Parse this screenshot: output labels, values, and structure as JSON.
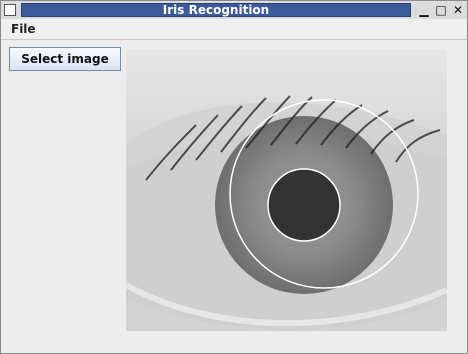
{
  "window": {
    "title": "Iris Recognition",
    "controls": {
      "minimize_icon": "minimize-icon",
      "maximize_icon": "maximize-icon",
      "close_icon": "close-icon"
    }
  },
  "menubar": {
    "items": [
      {
        "label": "File"
      }
    ]
  },
  "toolbar": {
    "select_image_label": "Select image"
  },
  "image": {
    "description_visible": "grayscale eye with pupil and iris circles",
    "colors": {
      "pupil": "#333333",
      "iris_outline": "#ffffff",
      "sclera": "#cfcfcf",
      "title_bar": "#3c5a99"
    }
  }
}
